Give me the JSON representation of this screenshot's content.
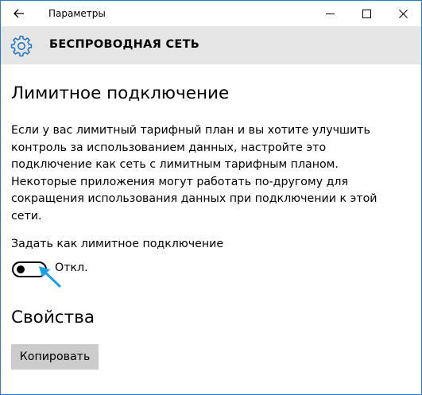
{
  "window": {
    "app_title": "Параметры"
  },
  "header": {
    "icon": "gear-icon",
    "title": "БЕСПРОВОДНАЯ СЕТЬ"
  },
  "metered": {
    "title": "Лимитное подключение",
    "description_lines": [
      "Если у вас лимитный тарифный план и вы хотите улучшить",
      "контроль за использованием данных, настройте это",
      "подключение как сеть с лимитным тарифным планом.",
      "Некоторые приложения могут работать по-другому для",
      "сокращения использования данных при подключении к этой",
      "сети."
    ],
    "toggle_label": "Задать как лимитное подключение",
    "toggle_state": "Откл.",
    "toggle_on": false
  },
  "properties": {
    "title": "Свойства",
    "copy_button": "Копировать"
  },
  "colors": {
    "window_border": "#2b78c2",
    "header_background": "#e6e6e6",
    "accent_icon": "#2b78c2",
    "pointer_arrow": "#1ba1e2",
    "button_background": "#cccccc"
  }
}
